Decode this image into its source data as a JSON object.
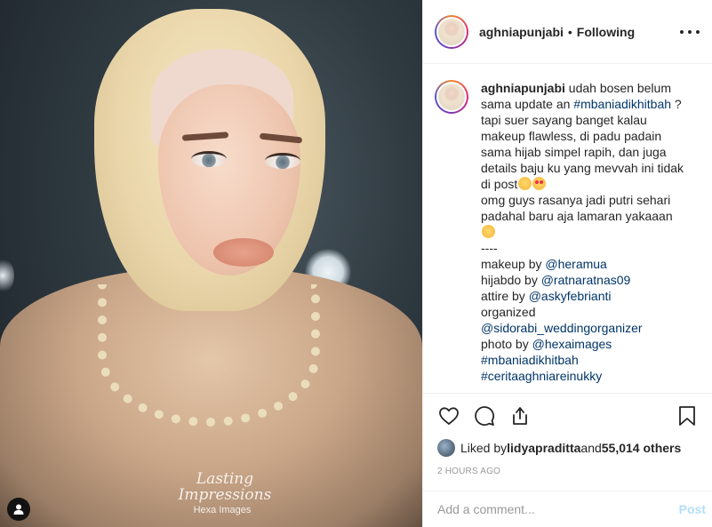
{
  "post": {
    "image_watermark_line1": "Lasting",
    "image_watermark_line2": "Impressions",
    "image_watermark_brand": "Hexa Images"
  },
  "header": {
    "username": "aghniapunjabi",
    "separator": "•",
    "follow_status": "Following"
  },
  "caption": {
    "username": "aghniapunjabi",
    "text_1": " udah bosen belum sama update an ",
    "hashtag_1": "#mbaniadikhitbah",
    "text_2": " ? tapi suer sayang banget kalau makeup flawless, di padu padain sama hijab simpel rapih, dan juga details baju ku yang mevvah ini tidak di post",
    "text_3": "omg guys rasanya jadi putri sehari padahal baru aja lamaran yakaaan",
    "divider": "----",
    "makeup_label": "makeup by ",
    "makeup_handle": "@heramua",
    "hijab_label": "hijabdo by ",
    "hijab_handle": "@ratnaratnas09",
    "attire_label": "attire by ",
    "attire_handle": "@askyfebrianti",
    "organized_label": "organized",
    "organized_handle": "@sidorabi_weddingorganizer",
    "photo_label": "photo by ",
    "photo_handle": "@hexaimages",
    "hashtag_2": "#mbaniadikhitbah",
    "hashtag_3": "#ceritaaghniareinukky",
    "time_ago": "2h"
  },
  "likes": {
    "prefix": "Liked by ",
    "user": "lidyapraditta",
    "middle": " and ",
    "count": "55,014 others"
  },
  "date": "2 HOURS AGO",
  "comment_box": {
    "placeholder": "Add a comment...",
    "post_label": "Post"
  },
  "colors": {
    "link": "#003569",
    "muted": "#999999",
    "post_disabled": "#b2dffc",
    "text": "#262626"
  },
  "icons": [
    "heart-icon",
    "comment-icon",
    "share-icon",
    "bookmark-icon",
    "more-options-icon",
    "person-tag-icon"
  ]
}
